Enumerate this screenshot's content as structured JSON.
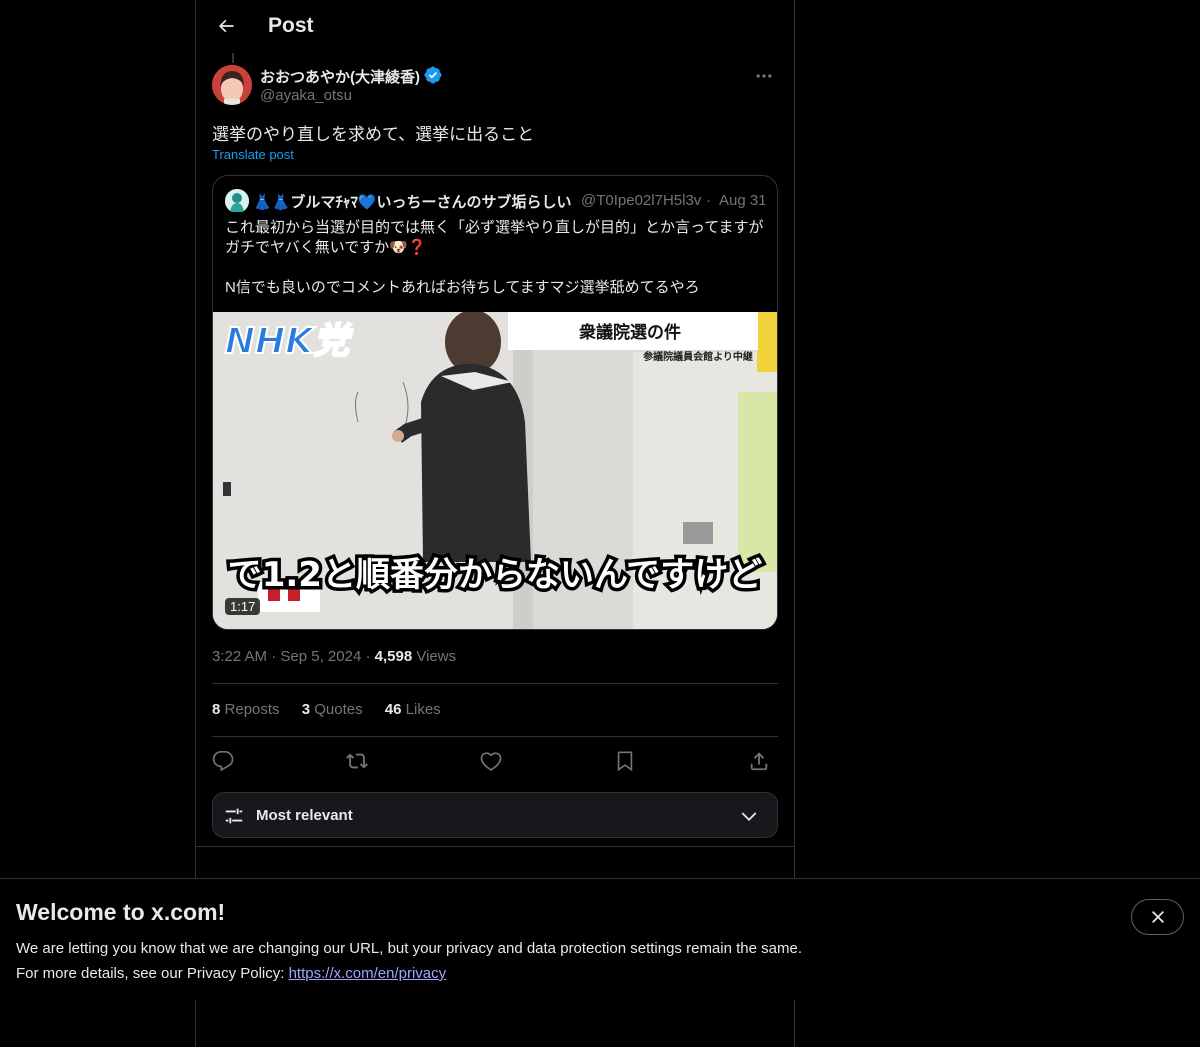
{
  "header": {
    "title": "Post"
  },
  "author": {
    "name": "おおつあやか(大津綾香)",
    "handle": "@ayaka_otsu"
  },
  "post": {
    "text": "選挙のやり直しを求めて、選挙に出ること",
    "translate_label": "Translate post"
  },
  "quote": {
    "name": "👗👗ブルマﾁｬﾏ💙いっちーさんのサブ垢らしい",
    "handle": "@T0Ipe02l7H5l3v",
    "date": "Aug 31",
    "text": "これ最初から当選が目的では無く「必ず選挙やり直しが目的」とか言ってますがガチでヤバく無いですか🐶❓\n\nN信でも良いのでコメントあればお待ちしてますマジ選挙舐めてるやろ",
    "video": {
      "logo": "NHK党",
      "sign_title": "衆議院選の件",
      "sign_sub": "参議院議員会館より中継",
      "caption": "で1.2と順番分からないんですけど",
      "duration": "1:17"
    }
  },
  "meta": {
    "time": "3:22 AM",
    "date": "Sep 5, 2024",
    "views_count": "4,598",
    "views_label": "Views"
  },
  "stats": {
    "reposts": {
      "count": "8",
      "label": "Reposts"
    },
    "quotes": {
      "count": "3",
      "label": "Quotes"
    },
    "likes": {
      "count": "46",
      "label": "Likes"
    }
  },
  "sort": {
    "label": "Most relevant"
  },
  "banner": {
    "title": "Welcome to x.com!",
    "line1": "We are letting you know that we are changing our URL, but your privacy and data protection settings remain the same.",
    "line2": "For more details, see our Privacy Policy: ",
    "link": "https://x.com/en/privacy"
  },
  "colors": {
    "accent": "#1d9bf0",
    "background": "#000000",
    "border": "#2f3336",
    "muted": "#71767b"
  },
  "icons": [
    "back-arrow-icon",
    "verified-badge-icon",
    "more-icon",
    "reply-icon",
    "repost-icon",
    "like-icon",
    "bookmark-icon",
    "share-icon",
    "sort-sliders-icon",
    "chevron-down-icon",
    "close-icon"
  ]
}
